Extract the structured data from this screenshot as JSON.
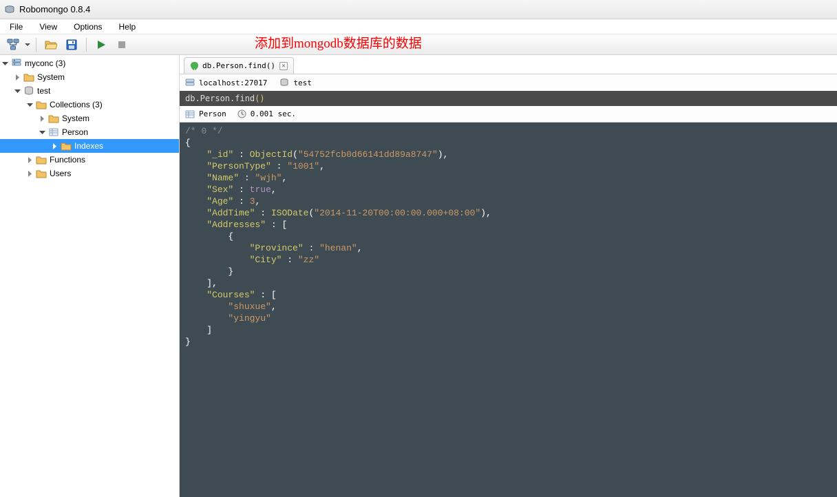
{
  "window": {
    "title": "Robomongo 0.8.4"
  },
  "menu": {
    "file": "File",
    "view": "View",
    "options": "Options",
    "help": "Help"
  },
  "annotation": "添加到mongodb数据库的数据",
  "sidebar": {
    "connection": "myconc (3)",
    "system": "System",
    "test_db": "test",
    "collections": "Collections (3)",
    "collections_system": "System",
    "person": "Person",
    "indexes": "Indexes",
    "functions": "Functions",
    "users": "Users"
  },
  "tab": {
    "label": "db.Person.find()"
  },
  "conn": {
    "host": "localhost:27017",
    "db": "test"
  },
  "query": {
    "prefix": "db.Person.find",
    "parens": "()"
  },
  "result": {
    "collection": "Person",
    "time": "0.001 sec."
  },
  "doc": {
    "comment": "/* 0 */",
    "k_id": "\"_id\"",
    "fn_objectid": "ObjectId",
    "v_id": "\"54752fcb0d66141dd89a8747\"",
    "k_persontype": "\"PersonType\"",
    "v_persontype": "\"1001\"",
    "k_name": "\"Name\"",
    "v_name": "\"wjh\"",
    "k_sex": "\"Sex\"",
    "v_sex": "true",
    "k_age": "\"Age\"",
    "v_age": "3",
    "k_addtime": "\"AddTime\"",
    "fn_isodate": "ISODate",
    "v_addtime": "\"2014-11-20T00:00:00.000+08:00\"",
    "k_addresses": "\"Addresses\"",
    "k_province": "\"Province\"",
    "v_province": "\"henan\"",
    "k_city": "\"City\"",
    "v_city": "\"zz\"",
    "k_courses": "\"Courses\"",
    "v_course1": "\"shuxue\"",
    "v_course2": "\"yingyu\""
  }
}
